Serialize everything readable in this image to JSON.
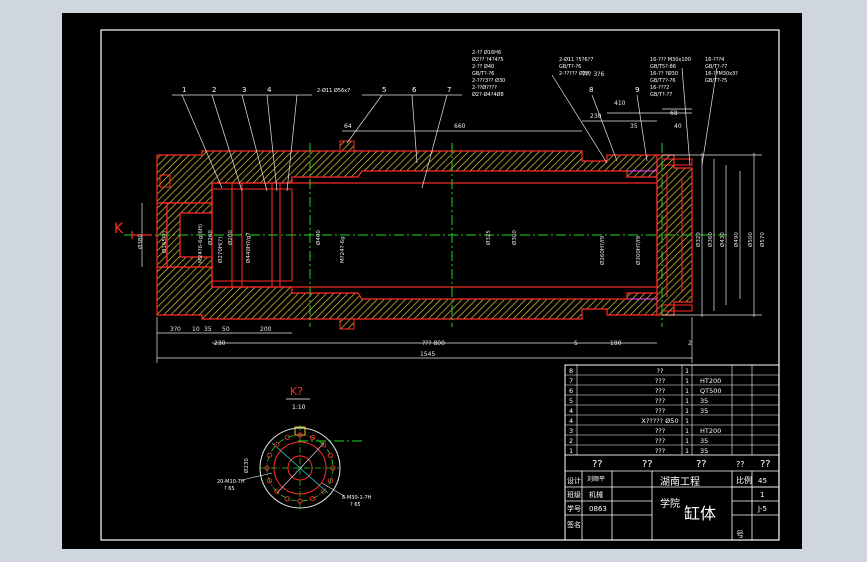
{
  "drawing": {
    "main_view": {
      "section_marker": "K",
      "balloons": [
        "1",
        "2",
        "3",
        "4",
        "5",
        "6",
        "7",
        "8",
        "9"
      ],
      "top_notes": {
        "note_a": "2-Ø11 Ø56x7",
        "note_b_lines": [
          "2-?? Ø16H6",
          "Ø2?? ?4?4?5",
          "2-?? Ø40",
          "GB/T?-?6",
          "2-???3?? Ø30",
          "2-??Ø????",
          "Ø2?-Ø4?4Ø8"
        ],
        "note_c_lines": [
          "2-Ø11 ?5?6?7",
          "GB/T?-?6",
          "2-????? Ø30"
        ],
        "note_d_lines": [
          "16-??? M30x100",
          "GB/T5?-86",
          "16-?? ?Ø30",
          "GB/T7?-?6",
          "16-???2",
          "GB/T?-?7"
        ],
        "note_e_lines": [
          "16-???4",
          "GB/T?-?7",
          "16-??M30x3?",
          "GB/T?-?5"
        ]
      },
      "dim_top": [
        "64",
        "660",
        "??? 3?6",
        "410",
        "230",
        "35",
        "68",
        "40"
      ],
      "dim_bottom": [
        "3?0",
        "10",
        "35",
        "50",
        "200",
        "230",
        "??? 800",
        "5",
        "190",
        "2",
        "1545"
      ],
      "dim_vertical_left": [
        "Ø380",
        "Ø165(?)"
      ],
      "dim_vertical_inner": [
        "M24?6-6g(6H)",
        "Ø260",
        "Ø270H(?)",
        "Ø200",
        "Ø440H?/g7",
        "Ø400",
        "M?24?-6g",
        "Ø325",
        "Ø300",
        "Ø260H?/f9",
        "Ø300H?/f9"
      ],
      "dim_vertical_right": [
        "Ø320",
        "Ø360",
        "Ø430",
        "Ø490",
        "Ø500",
        "Ø570"
      ]
    },
    "section_view": {
      "title": "K?",
      "scale": "1:10",
      "dim": "Ø230",
      "note_left_lines": [
        "20-M10-7H",
        "? 65"
      ],
      "note_right_lines": [
        "8-M30-1-7H",
        "? 65"
      ],
      "bolt_hole_count": 16
    },
    "parts_table": {
      "rows": [
        {
          "no": "8",
          "name": "??",
          "qty": "1",
          "material": ""
        },
        {
          "no": "7",
          "name": "???",
          "qty": "1",
          "material": "HT200"
        },
        {
          "no": "6",
          "name": "???",
          "qty": "1",
          "material": "QT500"
        },
        {
          "no": "5",
          "name": "???",
          "qty": "1",
          "material": "35"
        },
        {
          "no": "4",
          "name": "???",
          "qty": "1",
          "material": "35"
        },
        {
          "no": "4",
          "name": "X????? Ø50",
          "qty": "1",
          "material": ""
        },
        {
          "no": "3",
          "name": "???",
          "qty": "1",
          "material": "HT200"
        },
        {
          "no": "2",
          "name": "???",
          "qty": "1",
          "material": "35"
        },
        {
          "no": "1",
          "name": "???",
          "qty": "1",
          "material": "35"
        }
      ],
      "header": {
        "no": "??",
        "name": "??",
        "qty": "??",
        "material": "??",
        "remark": "??"
      }
    },
    "title_block": {
      "design_label": "设计",
      "design_name": "刘顺平",
      "class_label": "班级",
      "class_value": "机械",
      "id_label": "学号",
      "id_value": "0863",
      "school": "湖南工程",
      "school_sub": "学院",
      "drawing_name": "缸体",
      "scale_label": "比例",
      "scale_value": "45",
      "sheet_value": "1",
      "number_value": "J-5",
      "mark_label": "签名",
      "mark_char": "号"
    },
    "colors": {
      "outline_red": "#ff2a2a",
      "hatch_yellow": "#e6c832",
      "centerline_green": "#1fd61f",
      "text_white": "#ffffff",
      "dim_white": "#e8e8e8",
      "cyan": "#22e0e0",
      "magenta": "#ff40ff"
    }
  }
}
